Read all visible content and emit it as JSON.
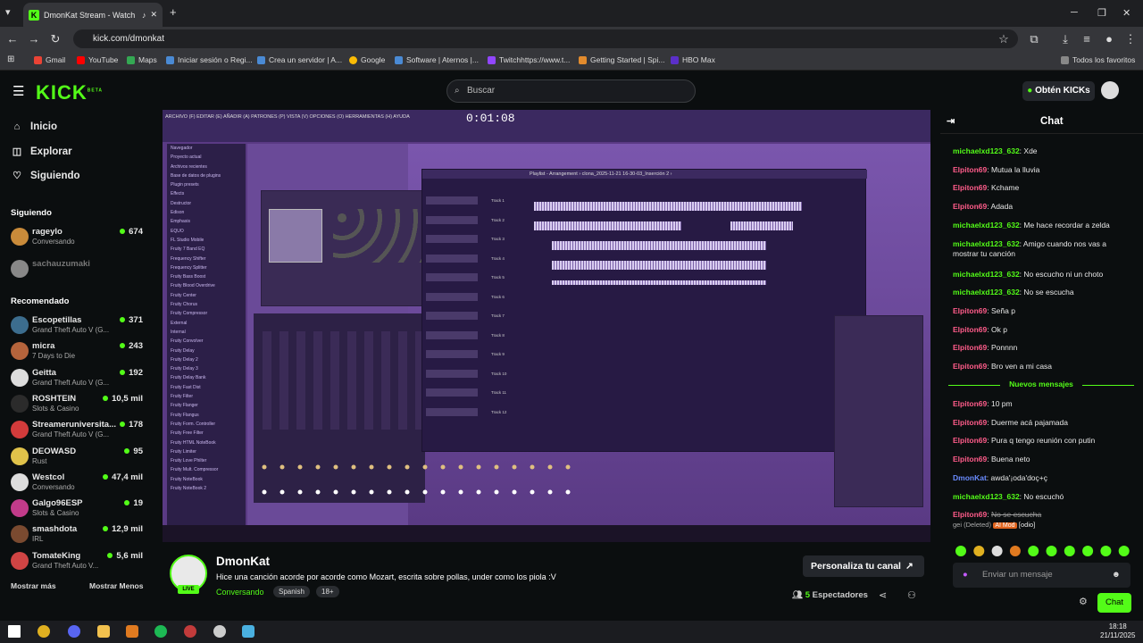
{
  "browser": {
    "tab_title": "DmonKat Stream - Watch L",
    "url": "kick.com/dmonkat",
    "bookmarks": [
      "Gmail",
      "YouTube",
      "Maps",
      "Iniciar sesión o Regi...",
      "Crea un servidor | A...",
      "Google",
      "Software | Aternos |...",
      "Twitchhttps://www.t...",
      "Getting Started | Spi...",
      "HBO Max"
    ],
    "all_bookmarks": "Todos los favoritos"
  },
  "header": {
    "logo": "KICK",
    "logo_beta": "BETA",
    "search_placeholder": "Buscar",
    "get_kicks": "Obtén KICKs"
  },
  "sidebar": {
    "nav": [
      {
        "label": "Inicio",
        "icon": "home-icon"
      },
      {
        "label": "Explorar",
        "icon": "compass-icon"
      },
      {
        "label": "Siguiendo",
        "icon": "heart-icon"
      }
    ],
    "following_title": "Siguiendo",
    "following": [
      {
        "name": "rageylo",
        "game": "Conversando",
        "viewers": "674",
        "color": "#c98b3a"
      },
      {
        "name": "sachauzumaki",
        "game": "",
        "viewers": "",
        "color": "#888888"
      }
    ],
    "recommended_title": "Recomendado",
    "recommended": [
      {
        "name": "Escopetillas",
        "game": "Grand Theft Auto V (G...",
        "viewers": "371",
        "color": "#3c6d8e"
      },
      {
        "name": "micra",
        "game": "7 Days to Die",
        "viewers": "243",
        "color": "#b5643c"
      },
      {
        "name": "Geitta",
        "game": "Grand Theft Auto V (G...",
        "viewers": "192",
        "color": "#dddddd"
      },
      {
        "name": "ROSHTEIN",
        "game": "Slots & Casino",
        "viewers": "10,5 mil",
        "color": "#2b2b2b"
      },
      {
        "name": "Streameruniversita...",
        "game": "Grand Theft Auto V (G...",
        "viewers": "178",
        "color": "#d23b3b"
      },
      {
        "name": "DEOWASD",
        "game": "Rust",
        "viewers": "95",
        "color": "#e0c24a"
      },
      {
        "name": "Westcol",
        "game": "Conversando",
        "viewers": "47,4 mil",
        "color": "#dddddd"
      },
      {
        "name": "Galgo96ESP",
        "game": "Slots & Casino",
        "viewers": "19",
        "color": "#c23b8a"
      },
      {
        "name": "smashdota",
        "game": "IRL",
        "viewers": "12,9 mil",
        "color": "#7a4a30"
      },
      {
        "name": "TomateKing",
        "game": "Grand Theft Auto V...",
        "viewers": "5,6 mil",
        "color": "#d04444"
      }
    ],
    "show_more": "Mostrar más",
    "show_less": "Mostrar Menos"
  },
  "video": {
    "fl_menu": "ARCHIVO (F) EDITAR (E) AÑADIR (A) PATRONES (P) VISTA (V) OPCIONES (O) HERRAMIENTAS (H) AYUDA",
    "fl_time": "0:01:08",
    "playlist_title": "Playlist - Arrangement › clona_2025-11-21 16-30-03_Inserción 2 ›",
    "browser_items": [
      "Navegador",
      "Proyecto actual",
      "Archivos recientes",
      "Base de datos de plugins",
      "Plugin presets",
      "Effects",
      "Destructor",
      "Edison",
      "Emphasis",
      "EQUO",
      "FL Studio Mobile",
      "Fruity 7 Band EQ",
      "Frequency Shifter",
      "Frequency Splitter",
      "Fruity Bass Boost",
      "Fruity Blood Overdrive",
      "Fruity Center",
      "Fruity Chorus",
      "Fruity Compressor",
      "External",
      "Internal",
      "Fruity Convolver",
      "Fruity Delay",
      "Fruity Delay 2",
      "Fruity Delay 3",
      "Fruity Delay Bank",
      "Fruity Fast Dist",
      "Fruity Filter",
      "Fruity Flanger",
      "Fruity Flangus",
      "Fruity Form. Controller",
      "Fruity Free Filter",
      "Fruity HTML NoteBook",
      "Fruity Limiter",
      "Fruity Love Philter",
      "Fruity Mult. Compressor",
      "Fruity NoteBook",
      "Fruity NoteBook 2"
    ],
    "tracks": [
      "Track 1",
      "Track 2",
      "Track 3",
      "Track 4",
      "Track 5",
      "Track 6",
      "Track 7",
      "Track 8",
      "Track 9",
      "Track 10",
      "Track 11",
      "Track 12"
    ]
  },
  "channel": {
    "name": "DmonKat",
    "live": "LIVE",
    "title": "Hice una canción acorde por acorde como Mozart, escrita sobre pollas, under como los piola :V",
    "category": "Conversando",
    "tags": [
      "Spanish",
      "18+"
    ],
    "customize": "Personaliza tu canal",
    "viewers_count": "5",
    "viewers_label": "Espectadores"
  },
  "chat": {
    "title": "Chat",
    "messages": [
      {
        "user": "michaelxd123_632",
        "color": "#53fc18",
        "text": "Xde"
      },
      {
        "user": "Elpiton69",
        "color": "#ff5c8a",
        "text": "Mutua la lluvia"
      },
      {
        "user": "Elpiton69",
        "color": "#ff5c8a",
        "text": "Kchame"
      },
      {
        "user": "Elpiton69",
        "color": "#ff5c8a",
        "text": "Adada"
      },
      {
        "user": "michaelxd123_632",
        "color": "#53fc18",
        "text": "Me hace recordar a zelda"
      },
      {
        "user": "michaelxd123_632",
        "color": "#53fc18",
        "text": "Amigo cuando nos vas a mostrar tu canción"
      },
      {
        "user": "michaelxd123_632",
        "color": "#53fc18",
        "text": "No escucho ni un choto"
      },
      {
        "user": "michaelxd123_632",
        "color": "#53fc18",
        "text": "No se escucha"
      },
      {
        "user": "Elpiton69",
        "color": "#ff5c8a",
        "text": "Seña p"
      },
      {
        "user": "Elpiton69",
        "color": "#ff5c8a",
        "text": "Ok p"
      },
      {
        "user": "Elpiton69",
        "color": "#ff5c8a",
        "text": "Ponnnn"
      },
      {
        "user": "Elpiton69",
        "color": "#ff5c8a",
        "text": "Bro ven a mi casa"
      }
    ],
    "new_messages": "Nuevos mensajes",
    "messages_new": [
      {
        "user": "Elpiton69",
        "color": "#ff5c8a",
        "text": "10 pm"
      },
      {
        "user": "Elpiton69",
        "color": "#ff5c8a",
        "text": "Duerme acá pajamada"
      },
      {
        "user": "Elpiton69",
        "color": "#ff5c8a",
        "text": "Pura q tengo reunión con putin"
      },
      {
        "user": "Elpiton69",
        "color": "#ff5c8a",
        "text": "Buena neto"
      },
      {
        "user": "DmonKat",
        "color": "#6a8cff",
        "text": "awda'¡oda'doç+ç"
      },
      {
        "user": "michaelxd123_632",
        "color": "#53fc18",
        "text": "No escuchó"
      }
    ],
    "deleted": {
      "user": "Elpiton69",
      "text": "No se escucha",
      "note": "gei (Deleted)",
      "mod_badge": "AI Mod",
      "mod_text": "[odio]"
    },
    "input_placeholder": "Enviar un mensaje",
    "send": "Chat"
  },
  "taskbar": {
    "time": "18:18",
    "date": "21/11/2025"
  },
  "colors": {
    "accent": "#53fc18",
    "background": "#0b0e0f",
    "video_purple": "#5a3a84"
  }
}
